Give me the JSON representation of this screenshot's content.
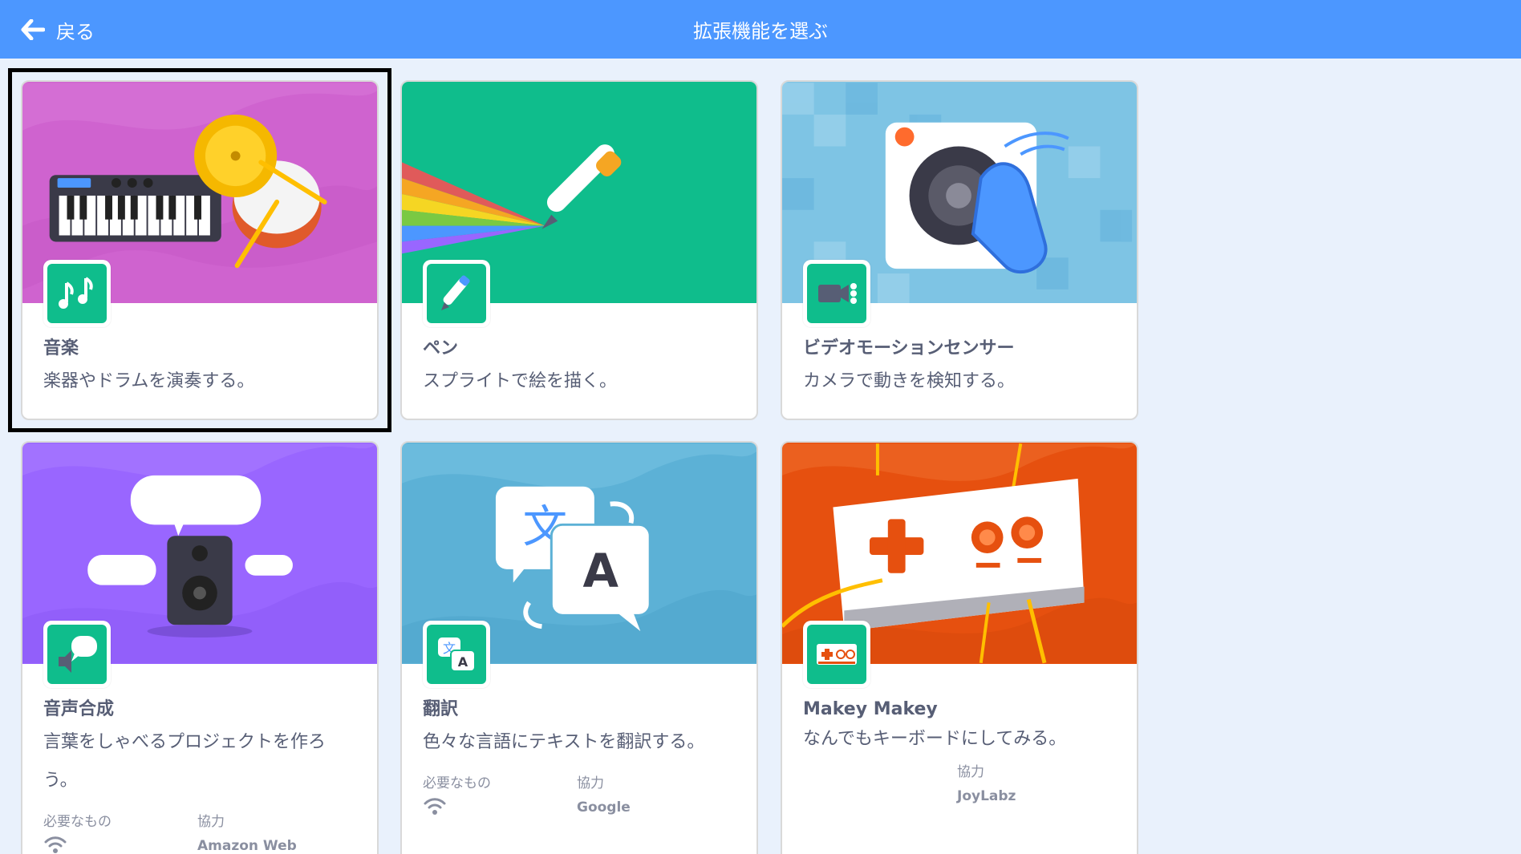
{
  "header": {
    "back_label": "戻る",
    "title": "拡張機能を選ぶ",
    "color": "#4c97ff"
  },
  "extensions": [
    {
      "title": "音楽",
      "description": "楽器やドラムを演奏する。",
      "banner_color": "#cf63cf",
      "icon": "music-notes-icon",
      "selected": true
    },
    {
      "title": "ペン",
      "description": "スプライトで絵を描く。",
      "banner_color": "#0fbd8c",
      "icon": "pen-icon"
    },
    {
      "title": "ビデオモーションセンサー",
      "description": "カメラで動きを検知する。",
      "banner_color": "#7ec4e4",
      "icon": "video-camera-icon"
    },
    {
      "title": "音声合成",
      "description": "言葉をしゃべるプロジェクトを作ろう。",
      "banner_color": "#9966ff",
      "icon": "speech-bubble-icon",
      "requires_label": "必要なもの",
      "requires_icon": "wifi-icon",
      "collab_label": "協力",
      "collab_value": "Amazon Web Services"
    },
    {
      "title": "翻訳",
      "description": "色々な言語にテキストを翻訳する。",
      "banner_color": "#5cb1d6",
      "icon": "translate-icon",
      "requires_label": "必要なもの",
      "requires_icon": "wifi-icon",
      "collab_label": "協力",
      "collab_value": "Google"
    },
    {
      "title": "Makey Makey",
      "description": "なんでもキーボードにしてみる。",
      "banner_color": "#e6500f",
      "icon": "makey-makey-icon",
      "collab_label": "協力",
      "collab_value": "JoyLabz"
    }
  ]
}
